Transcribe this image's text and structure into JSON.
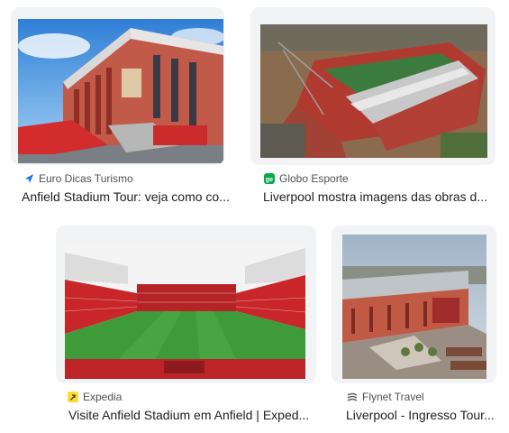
{
  "results": [
    {
      "source": "Euro Dicas Turismo",
      "favicon": "arrow-pointer-icon",
      "favicon_color": "#1a73e8",
      "title": "Anfield Stadium Tour: veja como co..."
    },
    {
      "source": "Globo Esporte",
      "favicon": "ge-logo-icon",
      "favicon_color": "#06aa48",
      "title": "Liverpool mostra imagens das obras d..."
    },
    {
      "source": "Expedia",
      "favicon": "expedia-logo-icon",
      "favicon_color": "#fddb32",
      "title": "Visite Anfield Stadium em Anfield | Exped..."
    },
    {
      "source": "Flynet Travel",
      "favicon": "flynet-logo-icon",
      "favicon_color": "#5f6368",
      "title": "Liverpool - Ingresso Tour..."
    }
  ]
}
